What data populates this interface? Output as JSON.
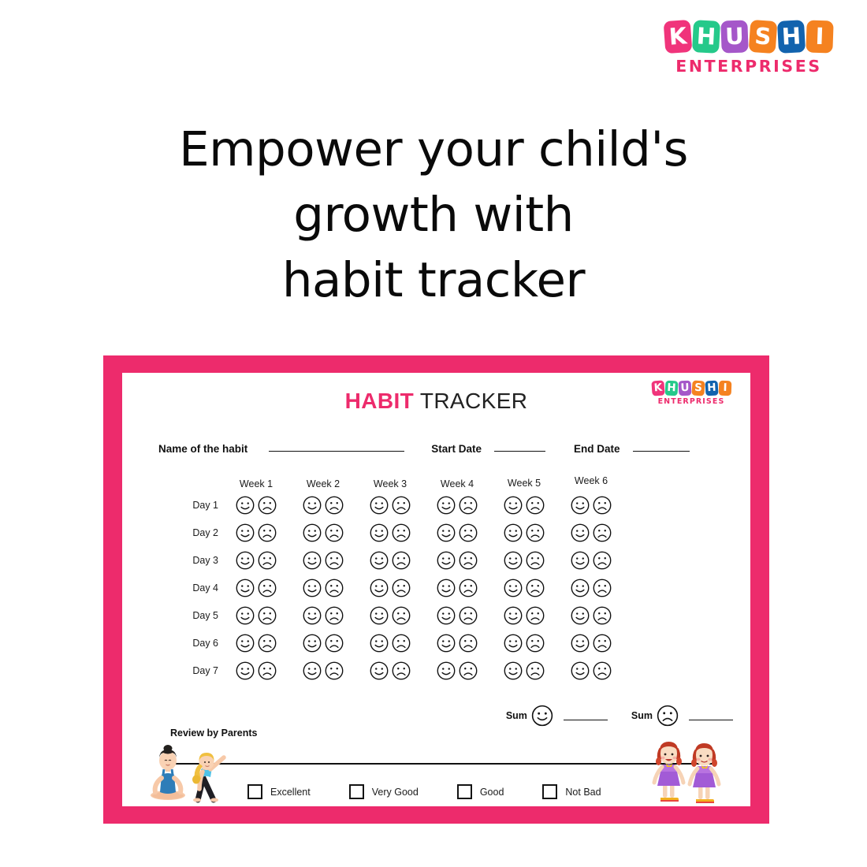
{
  "brand": {
    "name": "KHUSHI",
    "tagline": "ENTERPRISES",
    "letters": [
      {
        "char": "K",
        "color": "#F0347B"
      },
      {
        "char": "H",
        "color": "#25C98A"
      },
      {
        "char": "U",
        "color": "#A557C9"
      },
      {
        "char": "S",
        "color": "#F58220"
      },
      {
        "char": "H",
        "color": "#1263AE"
      },
      {
        "char": "I",
        "color": "#F58220"
      }
    ],
    "tagline_color": "#ED2B6C"
  },
  "headline": {
    "line1": "Empower your child's",
    "line2": "growth with",
    "line3": "habit tracker"
  },
  "card": {
    "frame_color": "#ED2B6C",
    "title_accent": "HABIT",
    "title_rest": "TRACKER",
    "accent_color": "#ED2B6C",
    "meta": {
      "habit_label": "Name of the habit",
      "start_label": "Start Date",
      "end_label": "End Date",
      "habit_value": "",
      "start_value": "",
      "end_value": ""
    },
    "weeks": [
      "Week 1",
      "Week 2",
      "Week 3",
      "Week 4",
      "Week 5",
      "Week 6"
    ],
    "days": [
      "Day 1",
      "Day 2",
      "Day 3",
      "Day 4",
      "Day 5",
      "Day 6",
      "Day 7"
    ],
    "cell_icons": [
      "happy-face-icon",
      "sad-face-icon"
    ],
    "sum": {
      "happy_label": "Sum",
      "happy_value": "",
      "sad_label": "Sum",
      "sad_value": ""
    },
    "review": {
      "label": "Review by Parents",
      "value": ""
    },
    "ratings": [
      {
        "label": "Excellent",
        "checked": false
      },
      {
        "label": "Very Good",
        "checked": false
      },
      {
        "label": "Good",
        "checked": false
      },
      {
        "label": "Not Bad",
        "checked": false
      }
    ],
    "illustrations": {
      "left": "yoga-kids-illustration",
      "right": "two-girls-illustration"
    }
  }
}
